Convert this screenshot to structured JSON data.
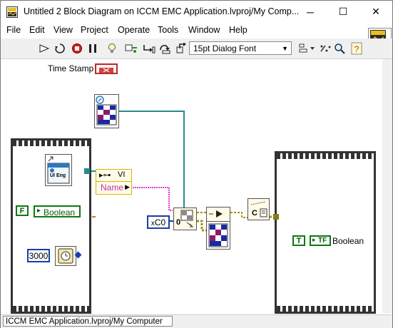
{
  "window": {
    "title": "Untitled 2 Block Diagram on ICCM EMC Application.lvproj/My Comp...",
    "minimize_glyph": "─",
    "maximize_glyph": "☐",
    "close_glyph": "✕"
  },
  "menu": {
    "items": [
      "File",
      "Edit",
      "View",
      "Project",
      "Operate",
      "Tools",
      "Window",
      "Help"
    ]
  },
  "toolbar": {
    "font_label": "15pt Dialog Font"
  },
  "connector_pane": {
    "number": "2"
  },
  "diagram": {
    "timestamp_label": "Time Stamp",
    "vi_ref_label": "UI Eng",
    "property_node_label": "VI",
    "property_name": "Name",
    "bool_constant": "F",
    "bool_indicator_left": "Boolean",
    "numeric_constant": "3000",
    "hex_constant": "C0",
    "hex_prefix": "x",
    "index_zero": "0",
    "right_bool_constant": "T",
    "right_bool_tf": "TF",
    "right_bool_label": "Boolean",
    "format_c": "C"
  },
  "status": {
    "context": "ICCM EMC Application.lvproj/My Computer"
  },
  "colors": {
    "numeric_blue": "#1a3cb0",
    "boolean_green": "#0a7a10",
    "string_pink": "#e040d0",
    "refnum_teal": "#2a8a8a",
    "error_gold": "#b08a10"
  }
}
